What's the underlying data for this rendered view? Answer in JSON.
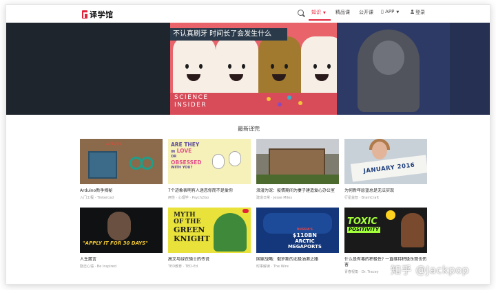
{
  "app": {
    "logo_text": "译学馆"
  },
  "nav": {
    "items": [
      {
        "label": "知识",
        "active": true
      },
      {
        "label": "精品课"
      },
      {
        "label": "公开课"
      },
      {
        "label": "APP"
      },
      {
        "label": "登录"
      }
    ],
    "search_icon": "search-icon",
    "user_icon": "user-icon"
  },
  "hero": {
    "banner_text": "不认真刷牙 时间长了会发生什么",
    "brand_line1": "SCIENCE",
    "brand_line2": "INSIDER"
  },
  "section": {
    "title": "最新译完"
  },
  "cards": [
    {
      "title": "Arduino新手揭秘",
      "meta": "入门工程 · Tinkercad",
      "thumb_text": "Arduino"
    },
    {
      "title": "7个迹象表明有人迷恋你而不是爱你",
      "meta": "两性 · 心理学 · Psych2Go",
      "thumb_lines": [
        "ARE THEY",
        "IN",
        "LOVE",
        "OR",
        "OBSESSED",
        "WITH YOU?"
      ]
    },
    {
      "title": "浪漫为宠：疫情期间为妻子建造爱心办公室",
      "meta": "建造日常 · Jesse Miles"
    },
    {
      "title": "为何新年愿望总是无法实现",
      "meta": "行星益智 · BrainCraft",
      "thumb_text": "JANUARY 2016"
    },
    {
      "title": "人生箴言",
      "meta": "励志心语 · Be Inspired",
      "thumb_text": "\"APPLY IT FOR 30 DAYS\""
    },
    {
      "title": "高文与绿衣骑士的传说",
      "meta": "TED教育 · TED-Ed",
      "thumb_lines": [
        "MYTH",
        "OF THE",
        "GREEN",
        "KNIGHT"
      ]
    },
    {
      "title": "国家战略：俄罗斯的北极油港之路",
      "meta": "时事解读 · The Wire",
      "thumb_lines": [
        "RUSSIA'S",
        "$110BN",
        "ARCTIC",
        "MEGAPORTS"
      ]
    },
    {
      "title": "什么是有毒的积极性? 一直维持积极乐观也伤害",
      "meta": "青春视角 · Dr. Tracey",
      "thumb_lines": [
        "TOXIC",
        "POSITIVITY"
      ]
    }
  ],
  "watermark": "知乎 @Jackpop"
}
